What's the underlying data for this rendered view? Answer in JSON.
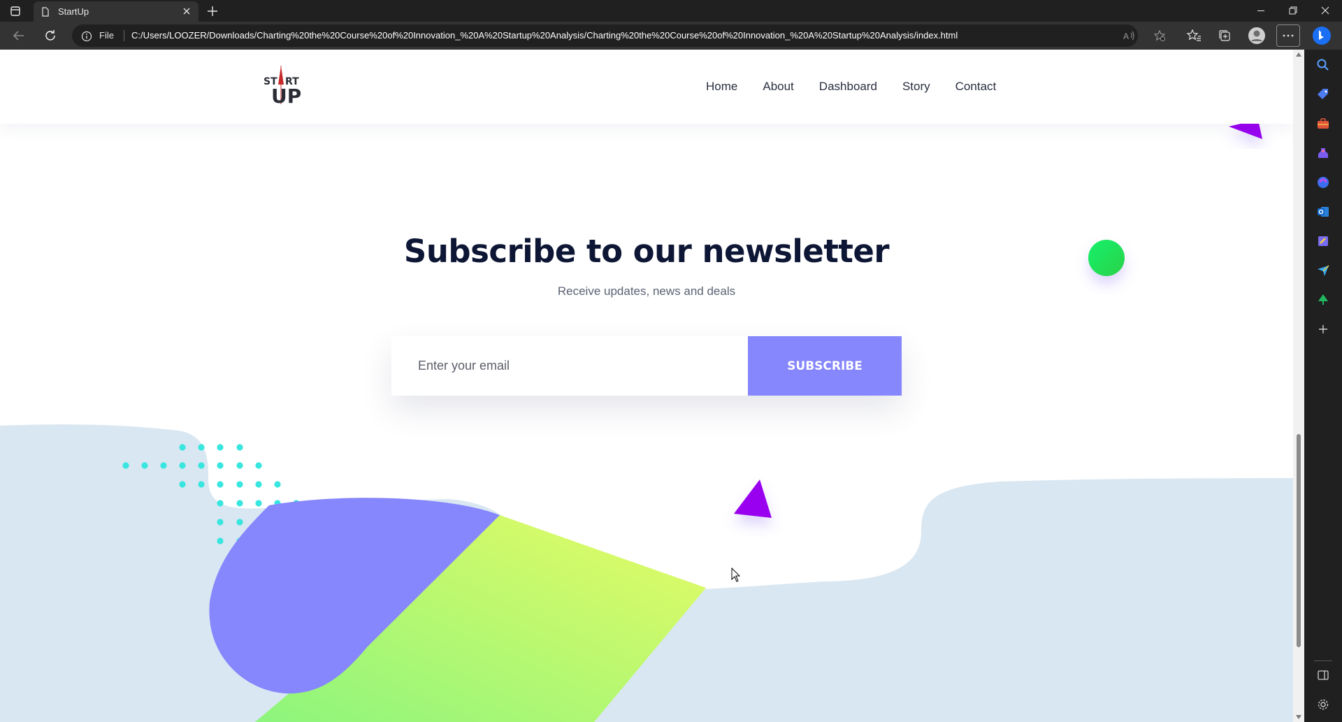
{
  "browser": {
    "tab_title": "StartUp",
    "file_label": "File",
    "url": "C:/Users/LOOZER/Downloads/Charting%20the%20Course%20of%20Innovation_%20A%20Startup%20Analysis/Charting%20the%20Course%20of%20Innovation_%20A%20Startup%20Analysis/index.html"
  },
  "site": {
    "logo_line1": "ST RT",
    "logo_line2": "UP",
    "nav": [
      "Home",
      "About",
      "Dashboard",
      "Story",
      "Contact"
    ]
  },
  "newsletter": {
    "title": "Subscribe to our newsletter",
    "subtitle": "Receive updates, news and deals",
    "email_placeholder": "Enter your email",
    "button_label": "SUBSCRIBE"
  },
  "colors": {
    "accent": "#8686fd",
    "heading": "#0d1634",
    "wave": "#d9e7f2",
    "dots": "#38e6df",
    "triangle": "#9a00f0",
    "ball": "#22e85a"
  }
}
